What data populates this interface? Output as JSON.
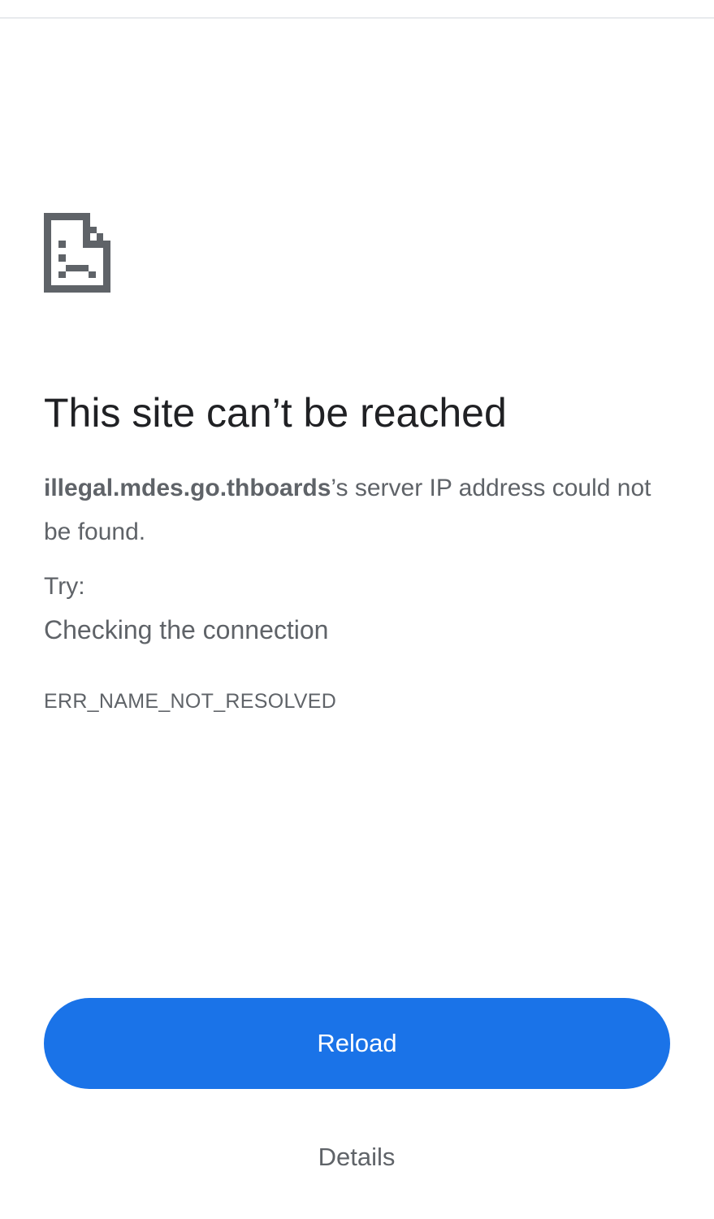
{
  "error_page": {
    "icon": "sad-page-icon",
    "headline": "This site can’t be reached",
    "host": "illegal.mdes.go.thboards",
    "summary_suffix": "’s server IP address could not be found.",
    "try_label": "Try:",
    "suggestion": "Checking the connection",
    "error_code": "ERR_NAME_NOT_RESOLVED"
  },
  "buttons": {
    "reload_label": "Reload",
    "details_label": "Details"
  },
  "colors": {
    "accent": "#1a73e8",
    "headline_text": "#202124",
    "body_text": "#5f6368",
    "icon": "#5f6368"
  }
}
